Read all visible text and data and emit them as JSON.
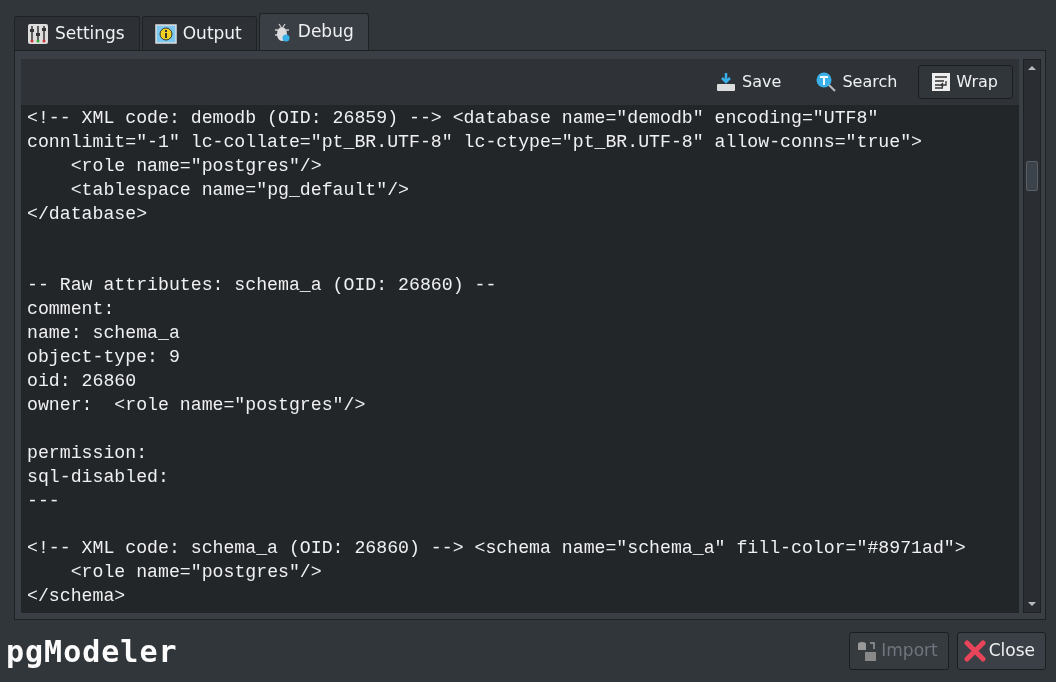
{
  "tabs": [
    {
      "label": "Settings",
      "selected": false,
      "kind": "sliders"
    },
    {
      "label": "Output",
      "selected": false,
      "kind": "info"
    },
    {
      "label": "Debug",
      "selected": true,
      "kind": "bug"
    }
  ],
  "toolbar": [
    {
      "label": "Save",
      "kind": "save",
      "checked": false
    },
    {
      "label": "Search",
      "kind": "search",
      "checked": false
    },
    {
      "label": "Wrap",
      "kind": "wrap",
      "checked": true
    }
  ],
  "code_view": {
    "wrap": true,
    "text": "<!-- XML code: demodb (OID: 26859) --> <database name=\"demodb\" encoding=\"UTF8\" connlimit=\"-1\" lc-collate=\"pt_BR.UTF-8\" lc-ctype=\"pt_BR.UTF-8\" allow-conns=\"true\">\n    <role name=\"postgres\"/>\n    <tablespace name=\"pg_default\"/>\n</database>\n\n\n-- Raw attributes: schema_a (OID: 26860) --\ncomment: \nname: schema_a\nobject-type: 9\noid: 26860\nowner:  <role name=\"postgres\"/>\n\npermission: \nsql-disabled: \n---\n\n<!-- XML code: schema_a (OID: 26860) --> <schema name=\"schema_a\" fill-color=\"#8971ad\">\n    <role name=\"postgres\"/>\n</schema>"
  },
  "footer": {
    "logo": "pgModeler",
    "buttons": [
      {
        "label": "Import",
        "kind": "import",
        "disabled": true
      },
      {
        "label": "Close",
        "kind": "close",
        "disabled": false
      }
    ]
  }
}
